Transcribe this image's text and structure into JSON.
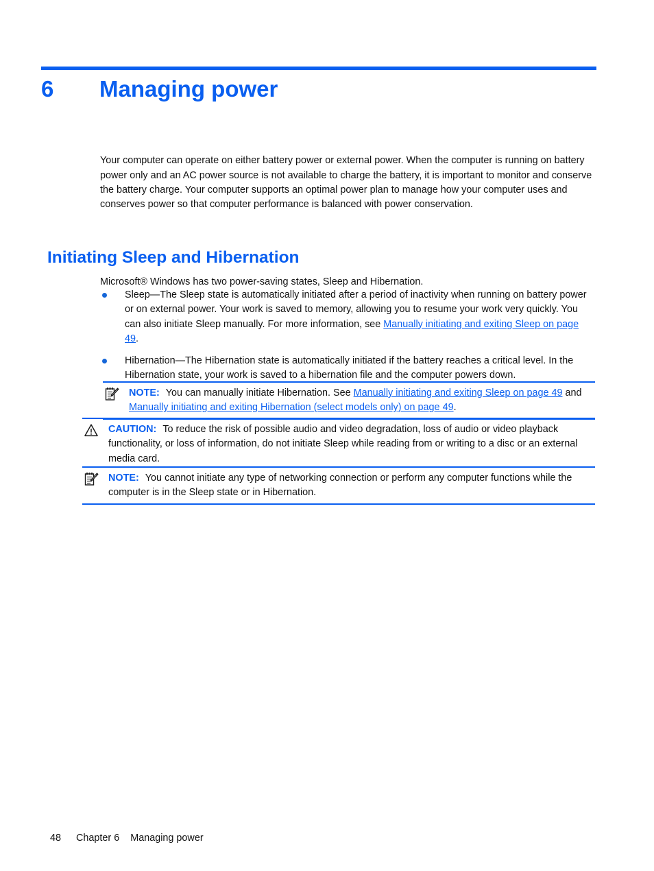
{
  "colors": {
    "accent_blue": "#0a5ff0",
    "link_blue": "#0a5ff0",
    "bullet_blue": "#1566d8",
    "text_black": "#111111",
    "page_background": "#ffffff"
  },
  "chapter": {
    "number": "6",
    "title": "Managing power"
  },
  "intro": {
    "paragraph": "Your computer can operate on either battery power or external power. When the computer is running on battery power only and an AC power source is not available to charge the battery, it is important to monitor and conserve the battery charge. Your computer supports an optimal power plan to manage how your computer uses and conserves power so that computer performance is balanced with power conservation."
  },
  "section": {
    "heading": "Initiating Sleep and Hibernation",
    "lead": "Microsoft® Windows has two power-saving states, Sleep and Hibernation."
  },
  "bullets": [
    {
      "text_before_link": "Sleep—The Sleep state is automatically initiated after a period of inactivity when running on battery power or on external power. Your work is saved to memory, allowing you to resume your work very quickly. You can also initiate Sleep manually. For more information, see ",
      "link": "Manually initiating and exiting Sleep on page 49",
      "text_after_link": "."
    },
    {
      "text_before_link": "Hibernation—The Hibernation state is automatically initiated if the battery reaches a critical level. In the Hibernation state, your work is saved to a hibernation file and the computer powers down.",
      "link": "",
      "text_after_link": ""
    }
  ],
  "admonitions": [
    {
      "icon": "note-icon",
      "label": "NOTE:",
      "text_before_link1": "You can manually initiate Hibernation. See ",
      "link1": "Manually initiating and exiting Sleep on page 49",
      "text_between_links": " and ",
      "link2": "Manually initiating and exiting Hibernation (select models only) on page 49",
      "text_after_link2": "."
    },
    {
      "icon": "caution-icon",
      "label": "CAUTION:",
      "text": "To reduce the risk of possible audio and video degradation, loss of audio or video playback functionality, or loss of information, do not initiate Sleep while reading from or writing to a disc or an external media card."
    },
    {
      "icon": "note-icon",
      "label": "NOTE:",
      "text": "You cannot initiate any type of networking connection or perform any computer functions while the computer is in the Sleep state or in Hibernation."
    }
  ],
  "footer": {
    "page_number": "48",
    "chapter_label": "Chapter 6",
    "chapter_title": "Managing power"
  }
}
